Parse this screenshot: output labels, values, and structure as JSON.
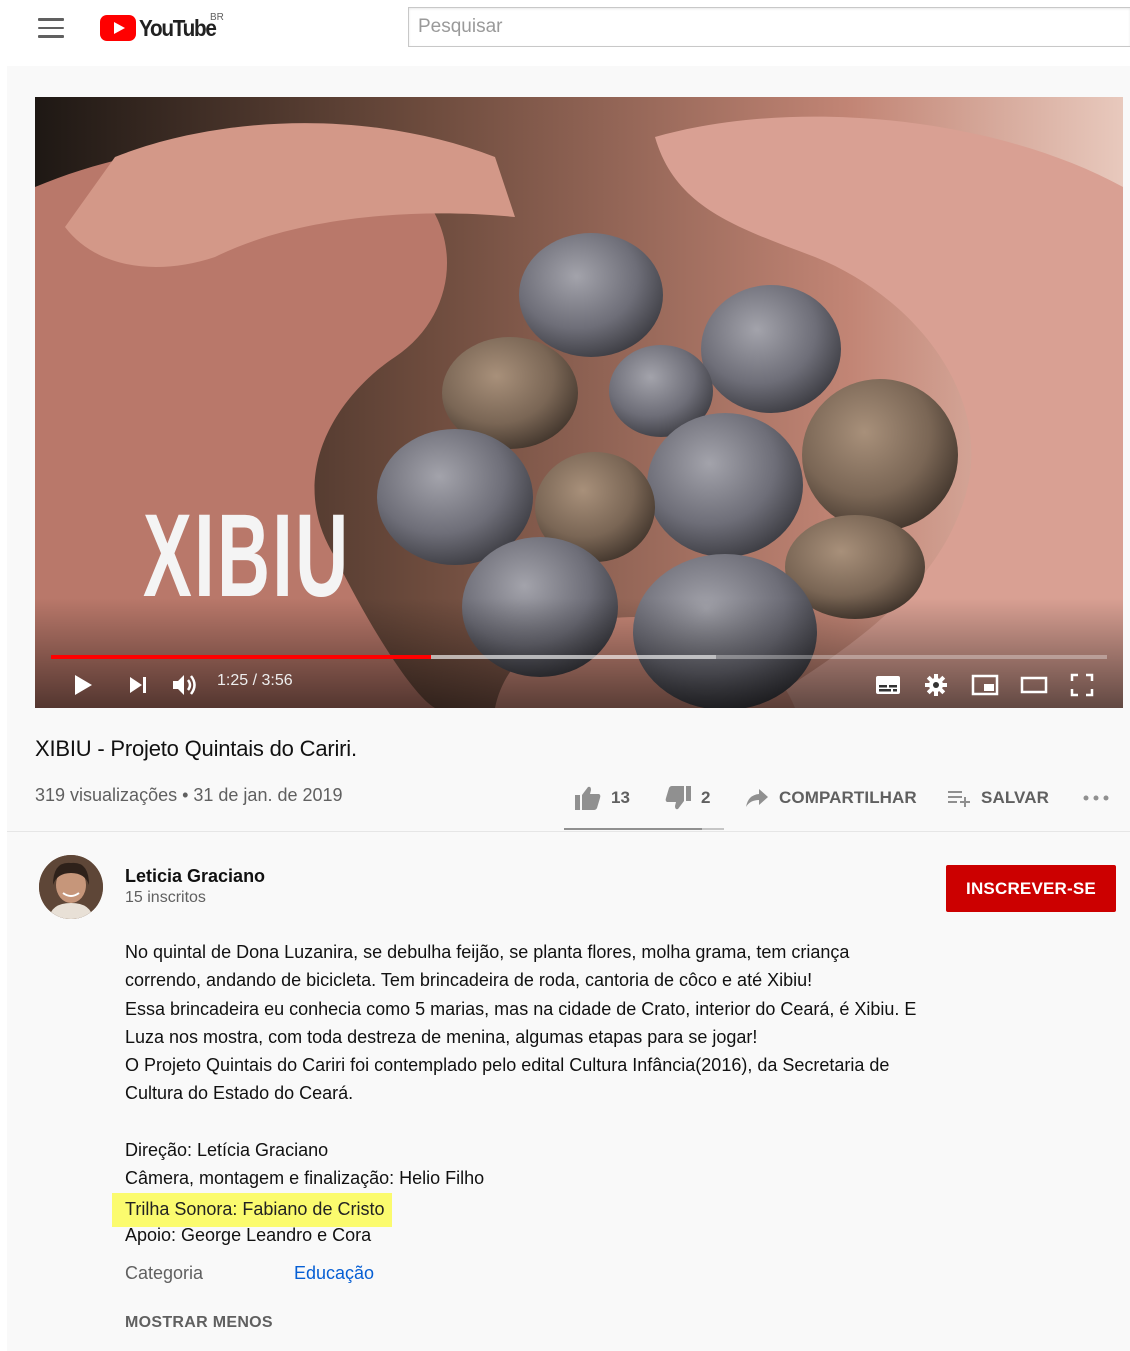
{
  "masthead": {
    "logo_text": "YouTube",
    "region": "BR",
    "search_placeholder": "Pesquisar"
  },
  "player": {
    "overlay_title": "XIBIU",
    "time": "1:25 / 3:56",
    "progress_played": 0.36,
    "progress_loaded": 0.63
  },
  "video": {
    "title": "XIBIU - Projeto Quintais do Cariri.",
    "meta": "319 visualizações • 31 de jan. de 2019",
    "likes": "13",
    "dislikes": "2",
    "share_label": "COMPARTILHAR",
    "save_label": "SALVAR"
  },
  "channel": {
    "name": "Leticia Graciano",
    "subscribers": "15 inscritos",
    "subscribe_label": "INSCREVER-SE"
  },
  "description": {
    "lines": [
      "No quintal de Dona Luzanira, se debulha feijão, se planta flores, molha grama, tem criança",
      "correndo, andando de bicicleta. Tem brincadeira de roda, cantoria de côco e até Xibiu!",
      "Essa brincadeira eu conhecia como 5 marias, mas na cidade de Crato, interior do Ceará, é Xibiu. E",
      "Luza nos mostra, com toda destreza de menina, algumas etapas para se jogar!",
      "O Projeto Quintais do Cariri foi contemplado pelo edital Cultura Infância(2016), da Secretaria de",
      "Cultura do Estado do Ceará."
    ],
    "credits": {
      "direction": "Direção: Letícia Graciano",
      "camera": "Câmera, montagem e finalização: Helio Filho",
      "soundtrack": "Trilha Sonora: Fabiano de Cristo",
      "support": "Apoio: George Leandro e Cora"
    },
    "category_label": "Categoria",
    "category_value": "Educação",
    "show_less": "MOSTRAR MENOS",
    "highlight_color": "#fbfb6e"
  },
  "colors": {
    "brand_red": "#ff0000",
    "subscribe_red": "#cc0000",
    "link_blue": "#065fd4"
  }
}
